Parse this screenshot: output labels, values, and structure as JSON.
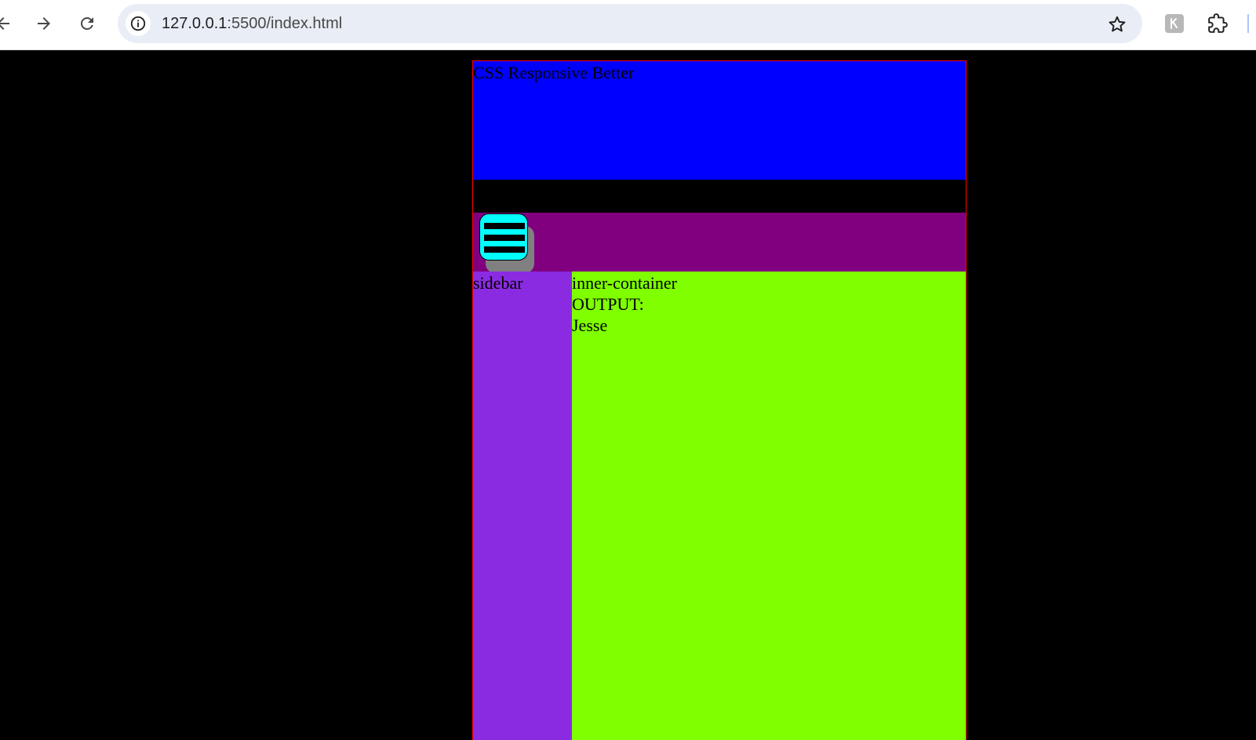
{
  "browser": {
    "url_host": "127.0.0.1",
    "url_path": ":5500/index.html",
    "icons": {
      "back": "arrow-back-icon",
      "forward": "arrow-forward-icon",
      "reload": "reload-icon",
      "site_info": "info-icon",
      "bookmark": "star-icon",
      "extension_1": "kalliope-extension-icon",
      "extensions": "puzzle-icon"
    }
  },
  "page": {
    "header_title": "CSS Responsive Better",
    "sidebar_label": "sidebar",
    "inner_container_label": "inner-container",
    "output_label": "OUTPUT:",
    "output_value": "Jesse",
    "colors": {
      "background": "#000000",
      "header": "#0000ff",
      "nav": "#800080",
      "hamburger": "#00ffff",
      "sidebar": "#8a2be2",
      "inner_container": "#7fff00",
      "container_border": "#ff0000"
    }
  }
}
